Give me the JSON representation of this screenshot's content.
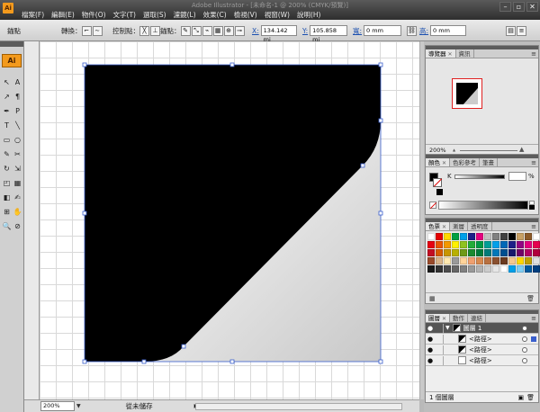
{
  "window": {
    "title": "Adobe Illustrator - [未命名-1 @ 200% (CMYK/預覽)]",
    "logo": "Ai",
    "minimize": "–",
    "maximize": "▫",
    "close": "✕"
  },
  "menus": [
    "檔案(F)",
    "編輯(E)",
    "物件(O)",
    "文字(T)",
    "選取(S)",
    "濾鏡(L)",
    "效果(C)",
    "檢視(V)",
    "視窗(W)",
    "說明(H)"
  ],
  "control_bar": {
    "selection_label": "錨點",
    "convert_label": "轉換：",
    "handles_label": "控制點：",
    "anchors_label": "錨點：",
    "x_label": "X:",
    "x_value": "134.142 mi",
    "y_label": "Y:",
    "y_value": "105.858 mi",
    "w_label": "寬:",
    "w_value": "0 mm",
    "h_label": "高:",
    "h_value": "0 mm"
  },
  "tools": {
    "ai_badge": "Ai",
    "glyphs": [
      "↖",
      "A",
      "↗",
      "¶",
      "✒",
      "P",
      "T",
      "╲",
      "▭",
      "○",
      "✎",
      "✂",
      "↻",
      "⇲",
      "◰",
      "▦",
      "◧",
      "✍",
      "⊞",
      "✋",
      "🔍",
      "⊘"
    ]
  },
  "status": {
    "zoom": "200%",
    "text": "從未儲存"
  },
  "navigator_panel": {
    "tabs": [
      "導覽器",
      "資訊"
    ],
    "zoom": "200%",
    "zoom_small": "▲",
    "zoom_large": "▲"
  },
  "color_panel": {
    "tabs": [
      "顏色",
      "色彩參考",
      "筆畫"
    ],
    "channel_label": "K",
    "channel_value": "",
    "percent": "%"
  },
  "swatches_panel": {
    "tabs": [
      "色票",
      "漸層",
      "透明度"
    ],
    "colors": [
      "#ffffff",
      "#e40000",
      "#ffd800",
      "#00a040",
      "#00a0e9",
      "#1d2088",
      "#e4007f",
      "#c0c0c0",
      "#808080",
      "#404040",
      "#000000",
      "#c8a064",
      "#8c5a28",
      "#ffffff",
      "#e60012",
      "#ea5404",
      "#f39800",
      "#fff100",
      "#8fc31f",
      "#22ac38",
      "#009944",
      "#009e96",
      "#00a0e9",
      "#0068b7",
      "#1d2088",
      "#920783",
      "#e4007f",
      "#e5004f",
      "#c30d23",
      "#d75a00",
      "#c89600",
      "#b8b000",
      "#6f9a18",
      "#1a8a30",
      "#007b3a",
      "#007b78",
      "#0078b8",
      "#004f90",
      "#16186c",
      "#700466",
      "#b00063",
      "#b0003c",
      "#9a4a2a",
      "#d9b48a",
      "#ffe9b0",
      "#9a9a9a",
      "#ffd39a",
      "#f0a070",
      "#d88a50",
      "#b87040",
      "#8a5030",
      "#6a3a20",
      "#f5c890",
      "#ffd700",
      "#c0a000",
      "#e0e0e0",
      "#1a1a1a",
      "#333333",
      "#4d4d4d",
      "#666666",
      "#808080",
      "#999999",
      "#b3b3b3",
      "#cccccc",
      "#e6e6e6",
      "#ffffff",
      "#00a0e9",
      "#7fcef4",
      "#005a9e",
      "#003f7f"
    ],
    "footer_left": "▦",
    "footer_right": "🗑"
  },
  "layers_panel": {
    "tabs": [
      "圖層",
      "動作",
      "連結"
    ],
    "layer_name": "圖層 1",
    "rows": [
      "<路徑>",
      "<路徑>",
      "<路徑>"
    ],
    "footer": "1 個圖層"
  },
  "artwork": {
    "fill_color": "#000000",
    "gradient_start": "#ffffff",
    "gradient_end": "#c8c8c8",
    "selection_color": "#3a5fcd"
  }
}
